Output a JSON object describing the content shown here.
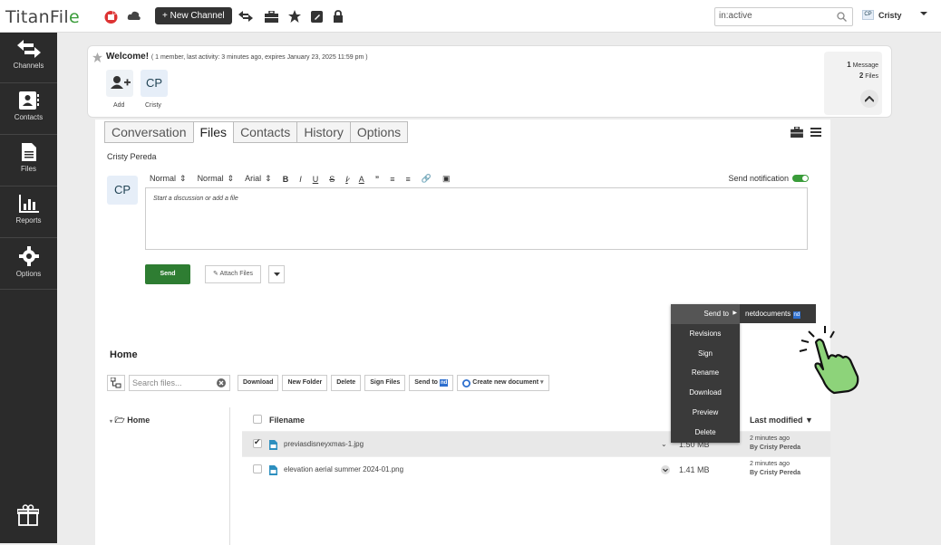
{
  "app": {
    "logo_text": "TitanFil",
    "logo_accent": "e",
    "brand_green": "#3a9c3a"
  },
  "topbar": {
    "new_channel_label": "+ New Channel",
    "search_value": "in:active",
    "user_initials": "CP",
    "user_name": "Cristy",
    "icons": [
      "gift-badge-icon",
      "cloud-icon",
      "transfer-icon",
      "briefcase-icon",
      "star-icon",
      "edit-icon",
      "lock-icon"
    ]
  },
  "sidebar": {
    "items": [
      {
        "label": "Channels",
        "icon": "channels-arrows-icon"
      },
      {
        "label": "Contacts",
        "icon": "contact-card-icon"
      },
      {
        "label": "Files",
        "icon": "file-icon"
      },
      {
        "label": "Reports",
        "icon": "bar-chart-icon"
      },
      {
        "label": "Options",
        "icon": "gear-icon"
      }
    ],
    "bottom_icon": "gift-icon"
  },
  "welcome": {
    "title": "Welcome!",
    "meta": "( 1 member, last activity: 3 minutes ago, expires January 23, 2025 11:59 pm )",
    "add_label": "Add",
    "member_initials": "CP",
    "member_name": "Cristy",
    "messages_count": "1",
    "messages_label": "Message",
    "files_count": "2",
    "files_label": "Files"
  },
  "tabs": [
    "Conversation",
    "Files",
    "Contacts",
    "History",
    "Options"
  ],
  "active_tab": "Files",
  "composer": {
    "owner_name": "Cristy Pereda",
    "avatar_initials": "CP",
    "toolbar": {
      "heading": "Normal",
      "size": "Normal",
      "font": "Arial",
      "bold": "B",
      "italic": "I",
      "underline": "U",
      "strike": "S"
    },
    "send_notification_label": "Send notification",
    "placeholder": "Start a discussion or add a file",
    "send_label": "Send",
    "attach_label": "Attach Files"
  },
  "files": {
    "home_title": "Home",
    "search_placeholder": "Search files...",
    "buttons": {
      "download": "Download",
      "new_folder": "New Folder",
      "delete": "Delete",
      "sign_files": "Sign Files",
      "send_to": "Send to",
      "create_doc": "Create new document"
    },
    "nd_badge": "nd",
    "tree_home": "Home",
    "columns": {
      "filename": "Filename",
      "last_modified": "Last modified ▼"
    },
    "rows": [
      {
        "name": "previasdisneyxmas-1.jpg",
        "size": "1.50 MB",
        "modified": "2 minutes ago",
        "by": "By Cristy Pereda",
        "selected": true
      },
      {
        "name": "elevation aerial summer 2024-01.png",
        "size": "1.41 MB",
        "modified": "2 minutes ago",
        "by": "By Cristy Pereda",
        "selected": false
      }
    ]
  },
  "context_menu": {
    "items": [
      "Send to",
      "Revisions",
      "Sign",
      "Rename",
      "Download",
      "Preview",
      "Delete"
    ],
    "submenu_label": "netdocuments",
    "submenu_badge": "nd"
  }
}
